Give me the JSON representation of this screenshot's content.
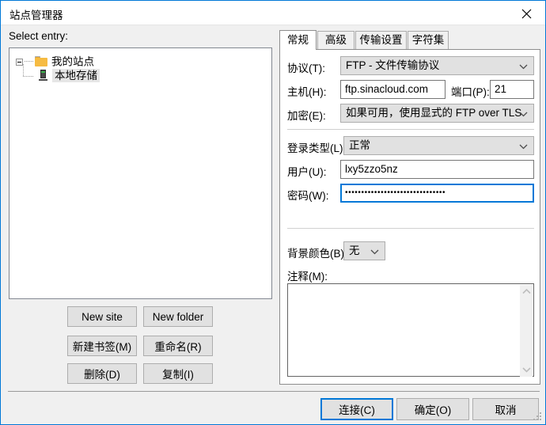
{
  "window": {
    "title": "站点管理器",
    "close_icon": "close-icon"
  },
  "left": {
    "select_entry_label": "Select entry:",
    "tree": {
      "root": {
        "label": "我的站点",
        "icon": "folder-icon"
      },
      "child": {
        "label": "本地存储",
        "icon": "server-icon",
        "selected": true
      }
    },
    "buttons": [
      {
        "label": "New site"
      },
      {
        "label": "New folder"
      },
      {
        "label": "新建书签(M)"
      },
      {
        "label": "重命名(R)"
      },
      {
        "label": "删除(D)"
      },
      {
        "label": "复制(I)"
      }
    ]
  },
  "tabs": [
    {
      "label": "常规",
      "active": true
    },
    {
      "label": "高级",
      "active": false
    },
    {
      "label": "传输设置",
      "active": false
    },
    {
      "label": "字符集",
      "active": false
    }
  ],
  "general": {
    "protocol": {
      "label": "协议(T):",
      "value": "FTP - 文件传输协议"
    },
    "host": {
      "label": "主机(H):",
      "value": "ftp.sinacloud.com"
    },
    "port": {
      "label": "端口(P):",
      "value": "21"
    },
    "encryption": {
      "label": "加密(E):",
      "value": "如果可用，使用显式的 FTP over TLS"
    },
    "logon_type": {
      "label": "登录类型(L):",
      "value": "正常"
    },
    "user": {
      "label": "用户(U):",
      "value": "lxy5zzo5nz"
    },
    "password": {
      "label": "密码(W):",
      "value": "•••••••••••••••••••••••••••••••",
      "focused": true
    },
    "background_color": {
      "label": "背景颜色(B)",
      "value": "无"
    },
    "comments": {
      "label": "注释(M):",
      "value": ""
    }
  },
  "footer": {
    "connect_label": "连接(C)",
    "ok_label": "确定(O)",
    "cancel_label": "取消"
  },
  "colors": {
    "accent": "#0078d7",
    "dialog_bg": "#f0f0f0",
    "button_bg": "#e1e1e1",
    "folder": "#f6bb42",
    "led_green": "#37b34a"
  }
}
